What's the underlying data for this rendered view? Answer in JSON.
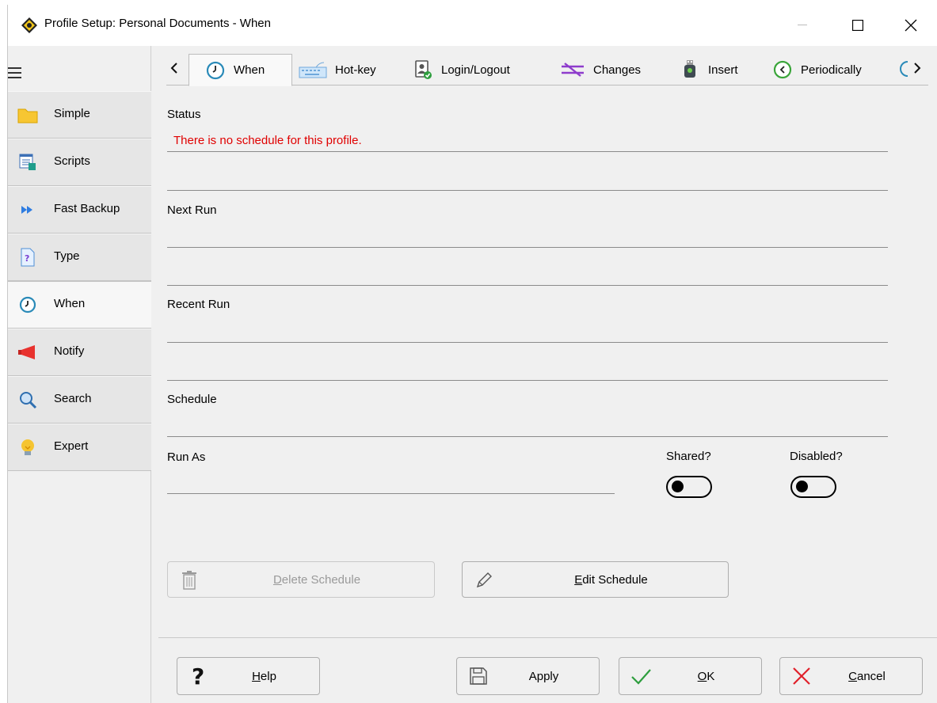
{
  "window": {
    "title": "Profile Setup: Personal Documents - When",
    "app_icon": "syncbackpro-logo-icon"
  },
  "sidebar": {
    "menu_icon": "hamburger-icon",
    "items": [
      {
        "label": "Simple",
        "icon": "folder-icon",
        "active": false
      },
      {
        "label": "Scripts",
        "icon": "scripts-icon",
        "active": false
      },
      {
        "label": "Fast Backup",
        "icon": "fast-forward-icon",
        "active": false
      },
      {
        "label": "Type",
        "icon": "document-question-icon",
        "active": false
      },
      {
        "label": "When",
        "icon": "clock-icon",
        "active": true
      },
      {
        "label": "Notify",
        "icon": "megaphone-icon",
        "active": false
      },
      {
        "label": "Search",
        "icon": "magnifier-icon",
        "active": false
      },
      {
        "label": "Expert",
        "icon": "lightbulb-icon",
        "active": false
      }
    ]
  },
  "tabs": {
    "items": [
      {
        "label": "When",
        "icon": "clock-icon",
        "active": true
      },
      {
        "label": "Hot-key",
        "icon": "keyboard-icon",
        "active": false
      },
      {
        "label": "Login/Logout",
        "icon": "user-check-icon",
        "active": false
      },
      {
        "label": "Changes",
        "icon": "changes-icon",
        "active": false
      },
      {
        "label": "Insert",
        "icon": "usb-plug-icon",
        "active": false
      },
      {
        "label": "Periodically",
        "icon": "periodic-clock-icon",
        "active": false
      }
    ]
  },
  "form": {
    "status_label": "Status",
    "status_message": "There is no schedule for this profile.",
    "next_run_label": "Next Run",
    "recent_run_label": "Recent Run",
    "schedule_label": "Schedule",
    "run_as_label": "Run As",
    "shared_label": "Shared?",
    "shared_value": false,
    "disabled_label": "Disabled?",
    "disabled_value": false
  },
  "schedule_buttons": {
    "delete_label_prefix": "D",
    "delete_label_rest": "elete Schedule",
    "delete_enabled": false,
    "edit_label_prefix": "E",
    "edit_label_rest": "dit Schedule"
  },
  "footer": {
    "help_prefix": "H",
    "help_rest": "elp",
    "apply_label": "Apply",
    "ok_prefix": "O",
    "ok_rest": "K",
    "cancel_prefix": "C",
    "cancel_rest": "ancel"
  },
  "colors": {
    "status_error": "#e00000",
    "ok_check": "#2e9e3e",
    "cancel_x": "#e0202a"
  }
}
